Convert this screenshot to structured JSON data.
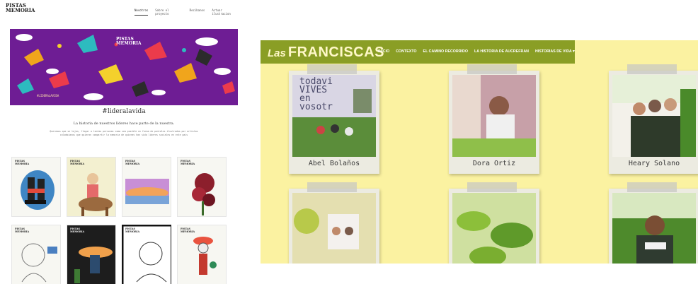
{
  "left_site": {
    "logo_lines": [
      "PISTAS",
      "MEMORIA"
    ],
    "nav": [
      {
        "label": "Nosotros",
        "active": true
      },
      {
        "label": "Sobre el proyecto",
        "active": false
      },
      {
        "label": "Recibanos",
        "active": false
      },
      {
        "label": "Actuar ilustracion",
        "active": false
      }
    ],
    "hero": {
      "caption": "#LIDERALAVIDA",
      "logo_lines": [
        "PISTAS",
        "MEMORIA"
      ],
      "background": "#6e1d94"
    },
    "title": "#lideralavida",
    "subtitle": "La historia de nuestros líderes hace parte de la nuestra.",
    "body": "Queremos que se tejan, llegar a tantas personas como sea posible en forma de postales ilustradas por artistas colombianos que quieran compartir la memoria de quienes han sido lideres sociales en este pais",
    "card_logo": [
      "PISTAS",
      "MEMORIA"
    ]
  },
  "right_site": {
    "brand": {
      "las": "Las",
      "name": "FRANCISCAS"
    },
    "nav": [
      "INICIO",
      "CONTEXTO",
      "EL CAMINO RECORRIDO",
      "LA HISTORIA DE AUCREFRAN",
      "HISTORIAS DE VIDA ▾"
    ],
    "photo_text": [
      "todavi",
      "VIVES",
      "en",
      "vosotr"
    ],
    "cards": [
      {
        "name": "Abel Bolaños"
      },
      {
        "name": "Dora Ortiz"
      },
      {
        "name": "Heary Solano"
      },
      {
        "name": ""
      },
      {
        "name": ""
      },
      {
        "name": ""
      }
    ],
    "colors": {
      "bar": "#8a9e25",
      "background": "#fbf2a1"
    }
  }
}
